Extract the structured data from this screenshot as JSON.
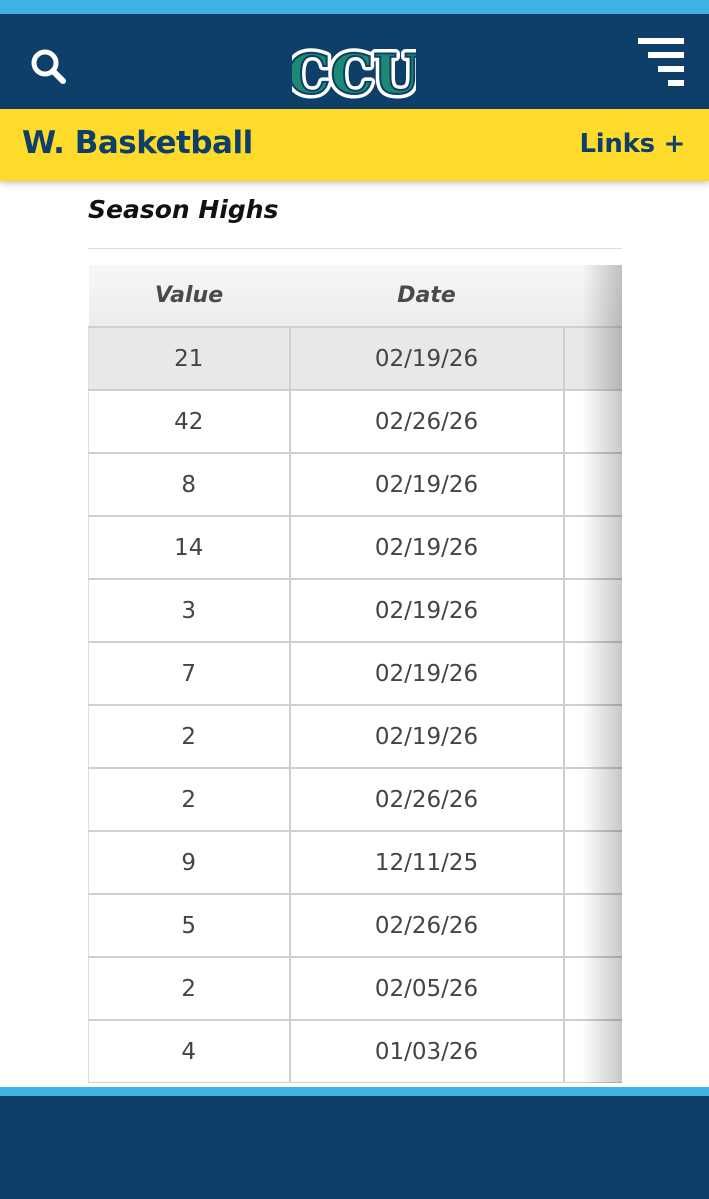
{
  "header": {
    "logo_text": "CCU",
    "search_icon": "search-icon",
    "menu_icon": "hamburger-menu-icon"
  },
  "subbar": {
    "sport": "W. Basketball",
    "links_label": "Links +"
  },
  "section": {
    "title": "Season Highs"
  },
  "table": {
    "columns": [
      "Value",
      "Date",
      ""
    ],
    "rows": [
      {
        "value": "21",
        "date": "02/19/26"
      },
      {
        "value": "42",
        "date": "02/26/26"
      },
      {
        "value": "8",
        "date": "02/19/26"
      },
      {
        "value": "14",
        "date": "02/19/26"
      },
      {
        "value": "3",
        "date": "02/19/26"
      },
      {
        "value": "7",
        "date": "02/19/26"
      },
      {
        "value": "2",
        "date": "02/19/26"
      },
      {
        "value": "2",
        "date": "02/26/26"
      },
      {
        "value": "9",
        "date": "12/11/25"
      },
      {
        "value": "5",
        "date": "02/26/26"
      },
      {
        "value": "2",
        "date": "02/05/26"
      },
      {
        "value": "4",
        "date": "01/03/26"
      }
    ]
  },
  "colors": {
    "navy": "#0e3f68",
    "sky": "#3eb2e3",
    "gold": "#fedb2a",
    "teal": "#1c8a73"
  }
}
